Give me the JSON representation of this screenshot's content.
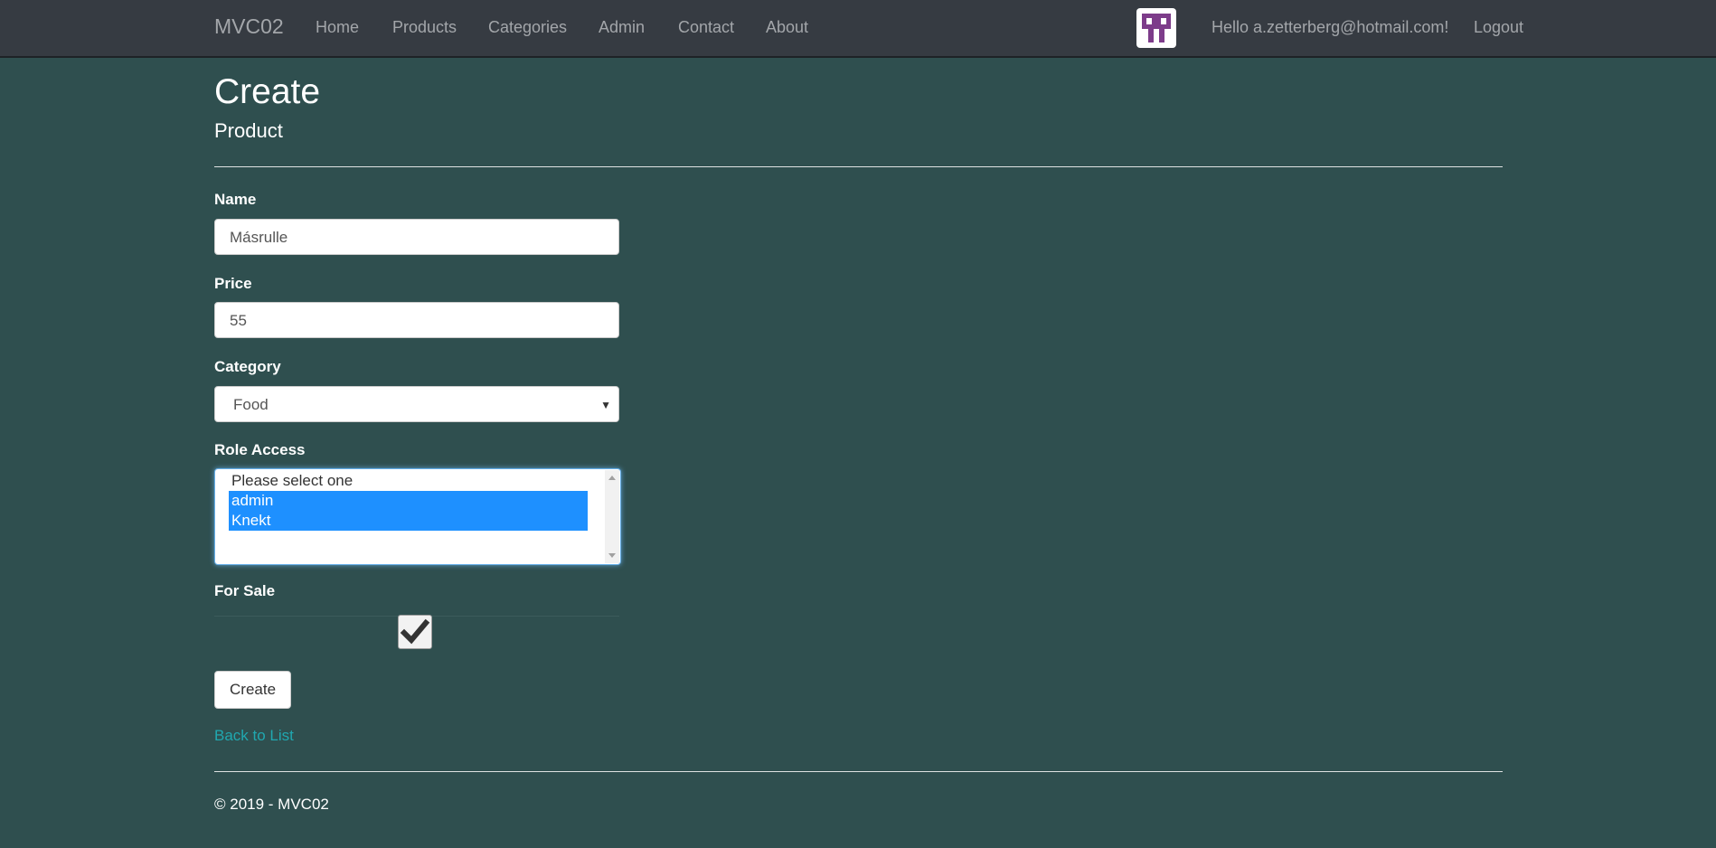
{
  "navbar": {
    "brand": "MVC02",
    "links": [
      "Home",
      "Products",
      "Categories",
      "Admin",
      "Contact",
      "About"
    ],
    "greeting": "Hello a.zetterberg@hotmail.com!",
    "logout": "Logout"
  },
  "page": {
    "title": "Create",
    "subtitle": "Product"
  },
  "form": {
    "name": {
      "label": "Name",
      "value": "Másrulle"
    },
    "price": {
      "label": "Price",
      "value": "55"
    },
    "category": {
      "label": "Category",
      "selected": "Food"
    },
    "role_access": {
      "label": "Role Access",
      "options": [
        {
          "text": "Please select one",
          "selected": false
        },
        {
          "text": "admin",
          "selected": true
        },
        {
          "text": "Knekt",
          "selected": true
        }
      ]
    },
    "for_sale": {
      "label": "For Sale",
      "checked": true
    },
    "submit_label": "Create"
  },
  "back_link": "Back to List",
  "footer": {
    "text": "© 2019 - MVC02"
  },
  "colors": {
    "background": "#2f4f4f",
    "navbar": "#363b42",
    "selection": "#1e90ff",
    "link": "#20a8b0"
  }
}
